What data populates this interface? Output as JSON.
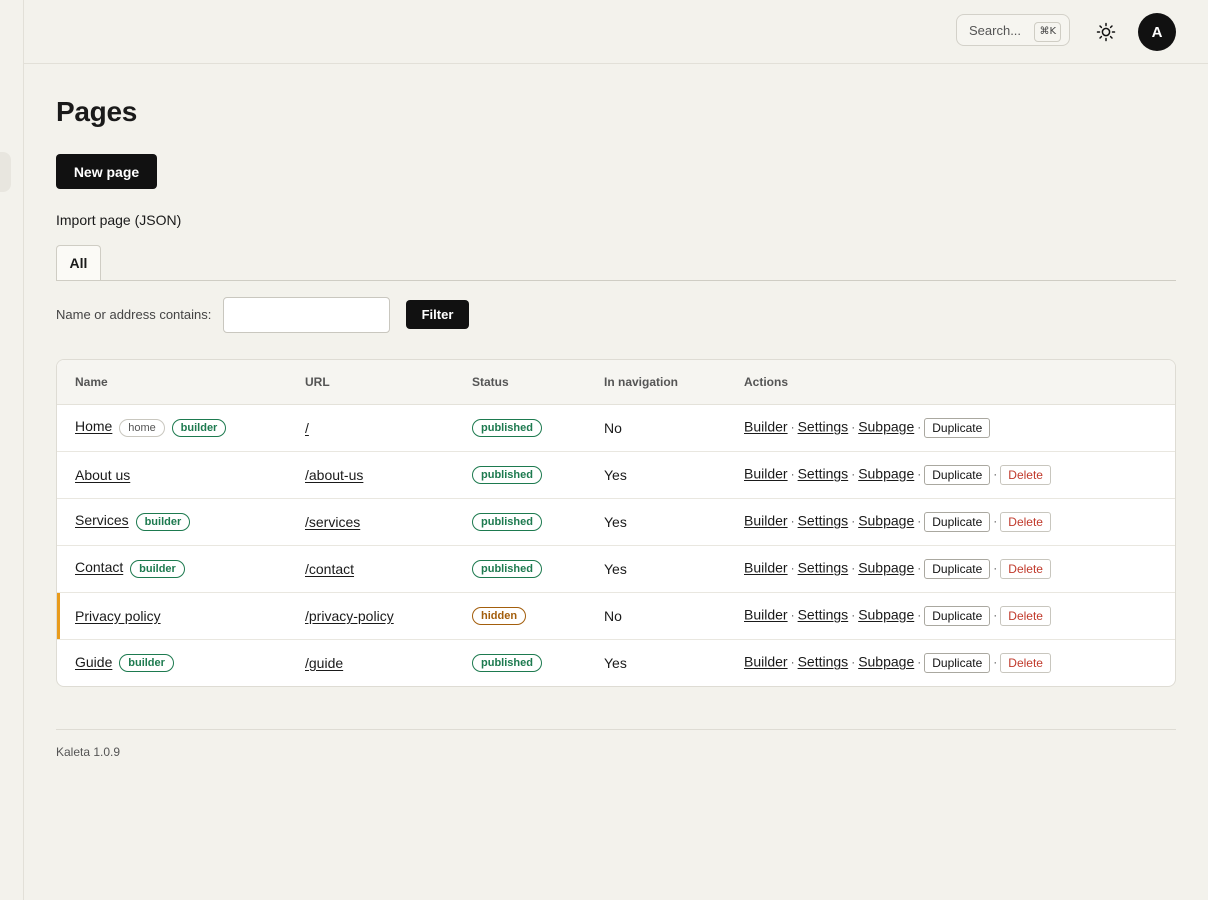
{
  "header": {
    "search_placeholder": "Search...",
    "search_shortcut": "⌘K",
    "theme_icon": "sun-icon",
    "avatar_initial": "A"
  },
  "page": {
    "title": "Pages",
    "new_page_label": "New page",
    "import_label": "Import page (JSON)"
  },
  "tabs": [
    {
      "label": "All",
      "active": true
    }
  ],
  "filter": {
    "label": "Name or address contains:",
    "value": "",
    "button_label": "Filter"
  },
  "table": {
    "columns": [
      "Name",
      "URL",
      "Status",
      "In navigation",
      "Actions"
    ],
    "rows": [
      {
        "name": "Home",
        "tags": [
          "home",
          "builder"
        ],
        "url": "/",
        "status": "published",
        "in_nav": "No",
        "can_delete": false
      },
      {
        "name": "About us",
        "tags": [],
        "url": "/about-us",
        "status": "published",
        "in_nav": "Yes",
        "can_delete": true
      },
      {
        "name": "Services",
        "tags": [
          "builder"
        ],
        "url": "/services",
        "status": "published",
        "in_nav": "Yes",
        "can_delete": true
      },
      {
        "name": "Contact",
        "tags": [
          "builder"
        ],
        "url": "/contact",
        "status": "published",
        "in_nav": "Yes",
        "can_delete": true
      },
      {
        "name": "Privacy policy",
        "tags": [],
        "url": "/privacy-policy",
        "status": "hidden",
        "in_nav": "No",
        "can_delete": true
      },
      {
        "name": "Guide",
        "tags": [
          "builder"
        ],
        "url": "/guide",
        "status": "published",
        "in_nav": "Yes",
        "can_delete": true
      }
    ],
    "actions": {
      "builder": "Builder",
      "settings": "Settings",
      "subpage": "Subpage",
      "duplicate": "Duplicate",
      "delete": "Delete",
      "separator": "·"
    }
  },
  "footer": {
    "version": "Kaleta 1.0.9"
  },
  "colors": {
    "background": "#f3f2ec",
    "primary": "#111111",
    "published": "#1d7a4f",
    "hidden": "#a35e0c",
    "delete": "#c0392b",
    "flag": "#e89b1c"
  }
}
